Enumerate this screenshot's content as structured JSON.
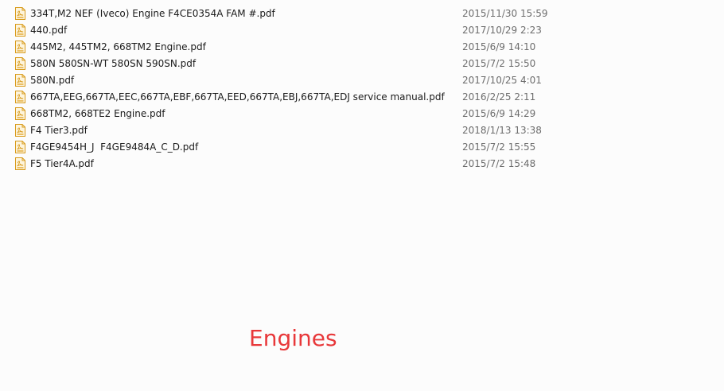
{
  "files": [
    {
      "name": "334T,M2 NEF (Iveco) Engine F4CE0354A FAM #.pdf",
      "date": "2015/11/30 15:59",
      "icon": "pdf-file-icon"
    },
    {
      "name": "440.pdf",
      "date": "2017/10/29 2:23",
      "icon": "pdf-file-icon"
    },
    {
      "name": "445M2, 445TM2, 668TM2 Engine.pdf",
      "date": "2015/6/9 14:10",
      "icon": "pdf-file-icon"
    },
    {
      "name": "580N 580SN-WT 580SN 590SN.pdf",
      "date": "2015/7/2 15:50",
      "icon": "pdf-file-icon"
    },
    {
      "name": "580N.pdf",
      "date": "2017/10/25 4:01",
      "icon": "pdf-file-icon"
    },
    {
      "name": "667TA,EEG,667TA,EEC,667TA,EBF,667TA,EED,667TA,EBJ,667TA,EDJ service manual.pdf",
      "date": "2016/2/25 2:11",
      "icon": "pdf-file-icon"
    },
    {
      "name": "668TM2, 668TE2 Engine.pdf",
      "date": "2015/6/9 14:29",
      "icon": "pdf-file-icon"
    },
    {
      "name": "F4 Tier3.pdf",
      "date": "2018/1/13 13:38",
      "icon": "pdf-file-icon"
    },
    {
      "name": "F4GE9454H_J  F4GE9484A_C_D.pdf",
      "date": "2015/7/2 15:55",
      "icon": "pdf-file-icon"
    },
    {
      "name": "F5 Tier4A.pdf",
      "date": "2015/7/2 15:48",
      "icon": "pdf-file-icon"
    }
  ],
  "caption": "Engines",
  "colors": {
    "caption": "#e8383a",
    "icon_stroke": "#d89b1c",
    "icon_fill": "#fdf4dc",
    "date_text": "#6d6d6d"
  }
}
